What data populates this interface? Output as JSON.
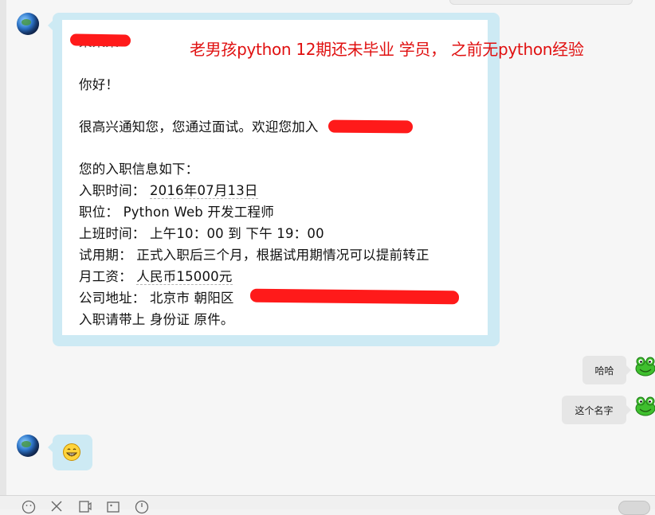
{
  "annotation": {
    "text": "老男孩python 12期还未毕业 学员， 之前无python经验",
    "color": "#e01010"
  },
  "letter": {
    "salutation_redacted": "某某某：",
    "greeting": "你好！",
    "notice": "很高兴通知您，您通过面试。欢迎您加入",
    "info_heading": "您的入职信息如下：",
    "start_date_label": "入职时间：",
    "start_date_value": "2016年07月13日",
    "position_label": "职位：",
    "position_value": "Python Web 开发工程师",
    "hours_label": "上班时间：",
    "hours_value": "上午10：00 到 下午 19：00",
    "probation_label": "试用期：",
    "probation_value": "正式入职后三个月，根据试用期情况可以提前转正",
    "salary_label": "月工资：",
    "salary_value": "人民币15000元",
    "address_label": "公司地址：",
    "address_value": "北京市 朝阳区",
    "documents": "入职请带上 身份证 原件。"
  },
  "messages": {
    "reply_1": "哈哈",
    "reply_2": "这个名字"
  },
  "toolbar": {
    "icons": [
      "emoji-icon",
      "scissors-icon",
      "file-icon",
      "image-icon",
      "clock-icon"
    ]
  },
  "colors": {
    "bubble_blue": "#cdeaf4",
    "bubble_gray": "#e6e6e6",
    "redaction": "#ff1a1a"
  }
}
